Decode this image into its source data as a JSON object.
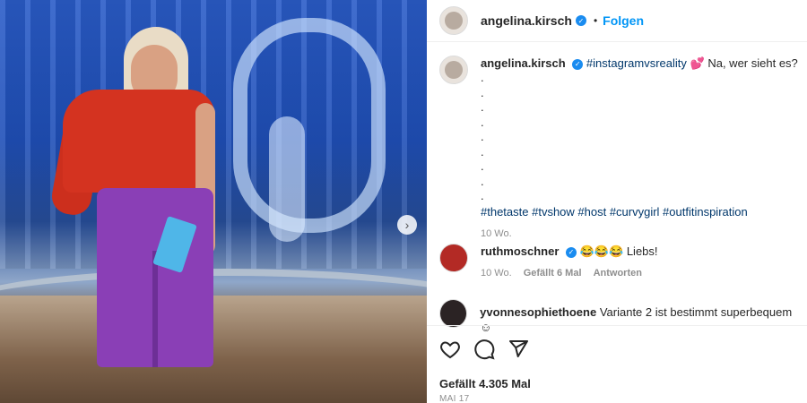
{
  "post": {
    "username": "angelina.kirsch",
    "follow_label": "Folgen",
    "dot": "•"
  },
  "caption": {
    "username": "angelina.kirsch",
    "hashtag1": "#instagramvsreality",
    "emoji": "💕",
    "text": "Na, wer sieht es?",
    "dots": [
      ".",
      ".",
      ".",
      ".",
      ".",
      ".",
      ".",
      ".",
      "."
    ],
    "tags": "#thetaste #tvshow #host #curvygirl #outfitinspiration",
    "age": "10 Wo."
  },
  "comments": [
    {
      "username": "ruthmoschner",
      "text": "😂😂😂 Liebs!",
      "age": "10 Wo.",
      "likes": "Gefällt 6 Mal",
      "reply": "Antworten"
    },
    {
      "username": "yvonnesophiethoene",
      "text": "Variante 2 ist bestimmt superbequem ☺"
    }
  ],
  "footer": {
    "likes": "Gefällt 4.305 Mal",
    "date": "MAI 17"
  },
  "icons": {
    "like": "heart-icon",
    "comment": "comment-icon",
    "share": "share-icon",
    "next": "chevron-right-icon",
    "verified": "verified-badge-icon"
  }
}
